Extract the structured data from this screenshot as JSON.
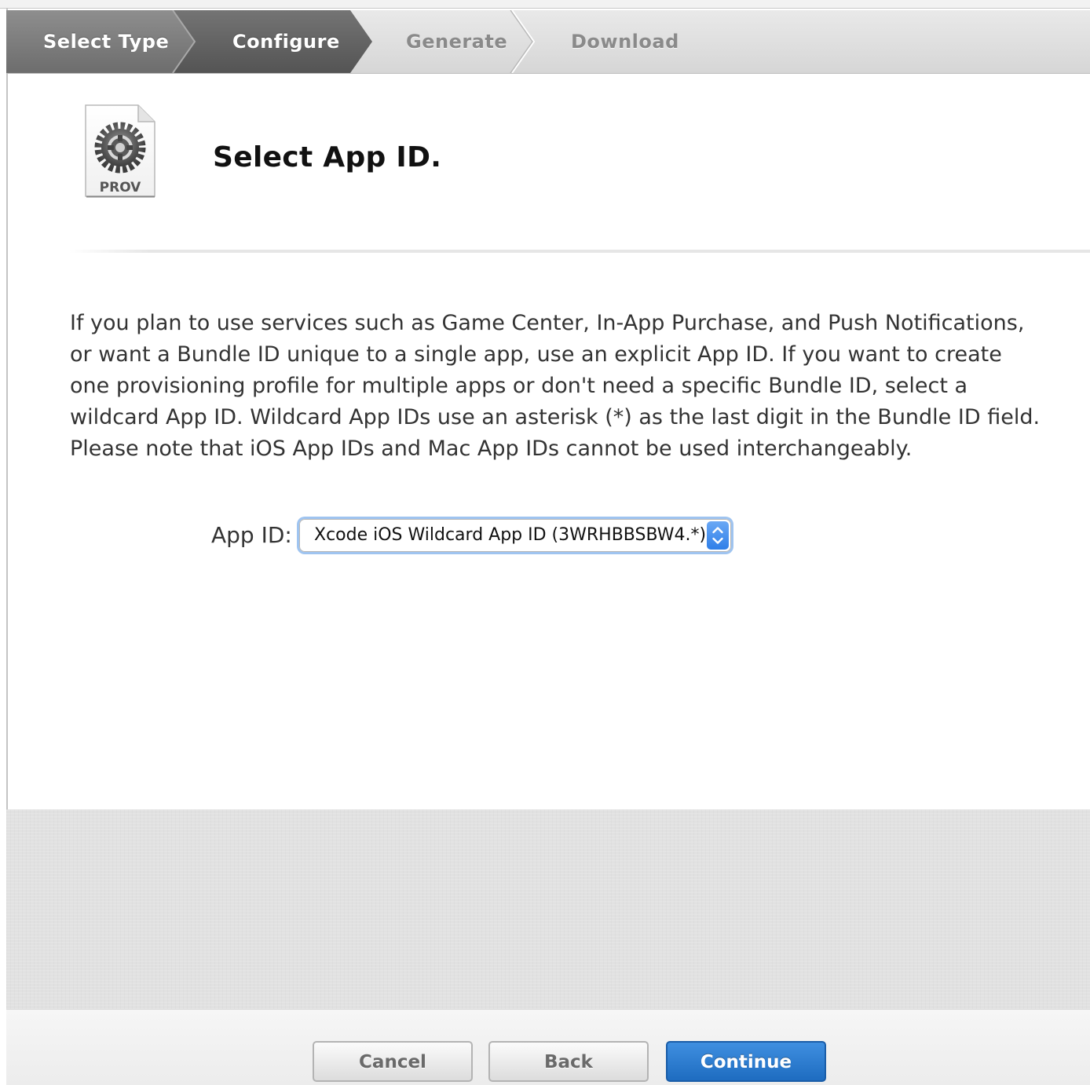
{
  "steps": [
    {
      "label": "Select Type",
      "state": "done"
    },
    {
      "label": "Configure",
      "state": "current"
    },
    {
      "label": "Generate",
      "state": "todo"
    },
    {
      "label": "Download",
      "state": "todo"
    }
  ],
  "header": {
    "icon_label": "PROV",
    "title": "Select App ID."
  },
  "description": "If you plan to use services such as Game Center, In-App Purchase, and Push Notifications, or want a Bundle ID unique to a single app, use an explicit App ID. If you want to create one provisioning profile for multiple apps or don't need a specific Bundle ID, select a wildcard App ID. Wildcard App IDs use an asterisk (*) as the last digit in the Bundle ID field. Please note that iOS App IDs and Mac App IDs cannot be used interchangeably.",
  "form": {
    "app_id_label": "App ID:",
    "app_id_selected": "Xcode iOS Wildcard App ID (3WRHBBSBW4.*)"
  },
  "footer": {
    "cancel_label": "Cancel",
    "back_label": "Back",
    "continue_label": "Continue"
  },
  "colors": {
    "step_done": "#7a7a7a",
    "step_current": "#5e5e5e",
    "accent_blue": "#2a78d0",
    "focus_ring": "#9fc4f0"
  }
}
